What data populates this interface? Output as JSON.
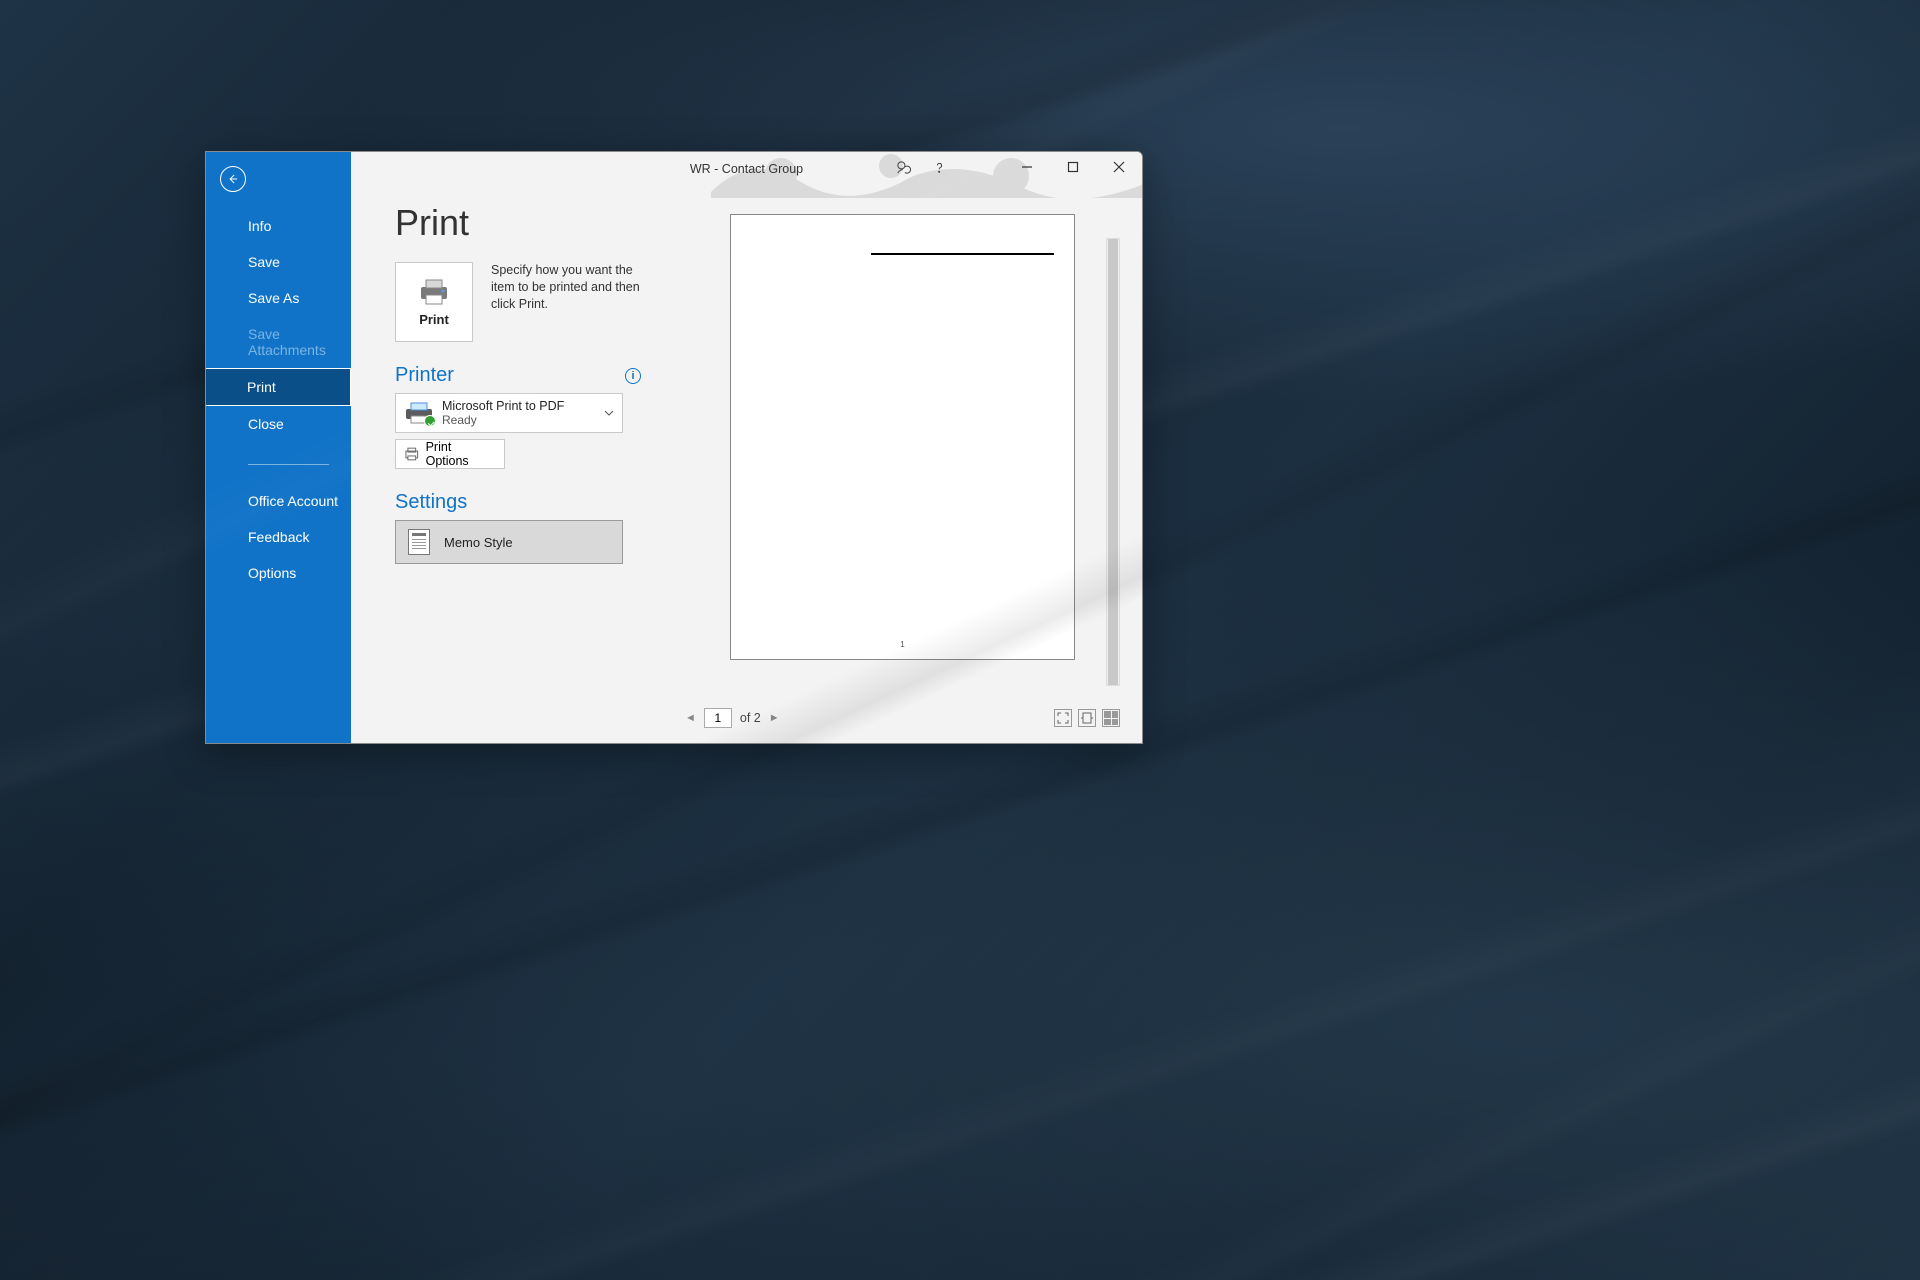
{
  "window": {
    "title": "WR  -  Contact Group"
  },
  "sidebar": {
    "items": [
      "Info",
      "Save",
      "Save As",
      "Save Attachments",
      "Print",
      "Close"
    ],
    "footer": [
      "Office Account",
      "Feedback",
      "Options"
    ],
    "active_index": 4,
    "disabled_index": 3
  },
  "main": {
    "heading": "Print",
    "print_button_label": "Print",
    "print_description": "Specify how you want the item to be printed and then click Print.",
    "printer_section": "Printer",
    "printer_name": "Microsoft Print to PDF",
    "printer_status": "Ready",
    "print_options_label": "Print Options",
    "settings_section": "Settings",
    "style_label": "Memo Style"
  },
  "pager": {
    "current": "1",
    "of_label": "of 2"
  }
}
